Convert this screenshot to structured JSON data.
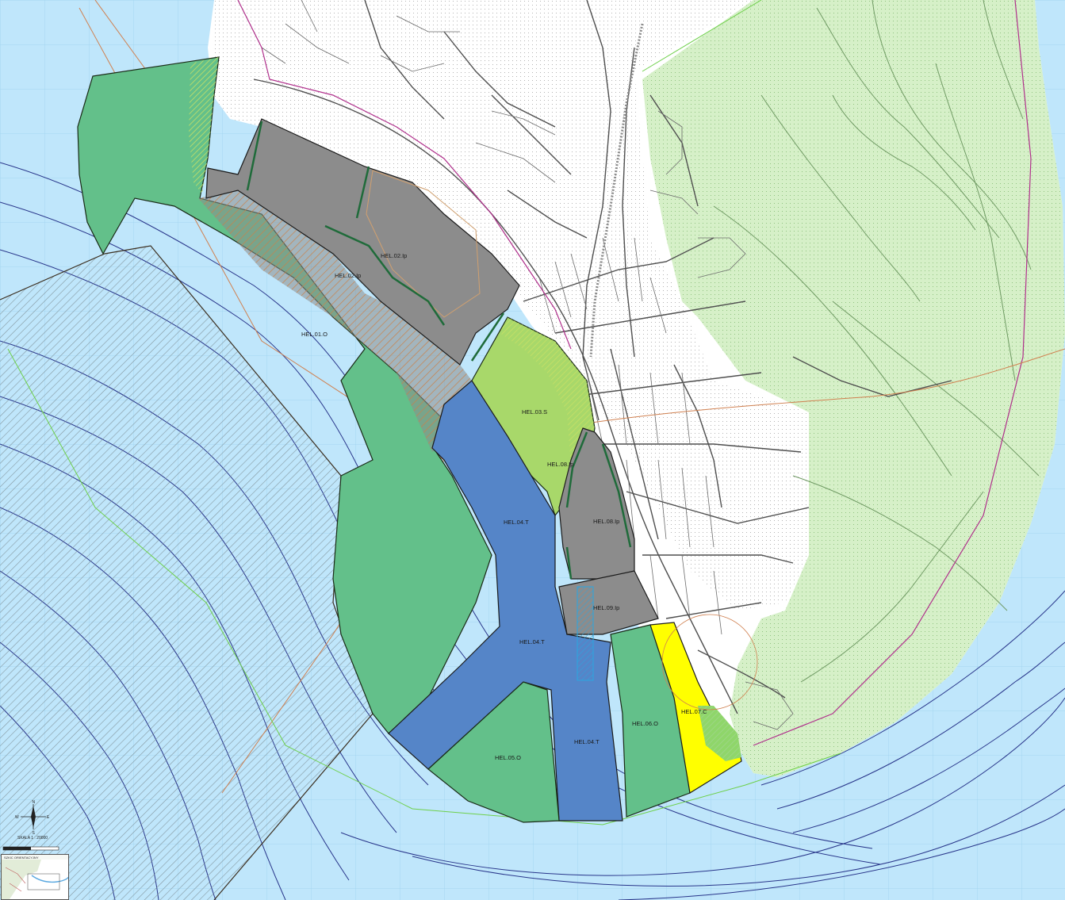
{
  "map": {
    "zones": [
      {
        "id": "HEL.01.O",
        "label": "HEL.01.O"
      },
      {
        "id": "HEL.02.Ip-a",
        "label": "HEL.02.Ip"
      },
      {
        "id": "HEL.02.Ip-b",
        "label": "HEL.02.Ip"
      },
      {
        "id": "HEL.03.S",
        "label": "HEL.03.S"
      },
      {
        "id": "HEL.04.T-a",
        "label": "HEL.04.T"
      },
      {
        "id": "HEL.04.T-b",
        "label": "HEL.04.T"
      },
      {
        "id": "HEL.04.T-c",
        "label": "HEL.04.T"
      },
      {
        "id": "HEL.05.O",
        "label": "HEL.05.O"
      },
      {
        "id": "HEL.06.O",
        "label": "HEL.06.O"
      },
      {
        "id": "HEL.07.C",
        "label": "HEL.07.C"
      },
      {
        "id": "HEL.08.Ip-a",
        "label": "HEL.08.Ip"
      },
      {
        "id": "HEL.08.Ip-b",
        "label": "HEL.08.Ip"
      },
      {
        "id": "HEL.09.Ip",
        "label": "HEL.09.Ip"
      }
    ],
    "colors": {
      "water": "#bfe6fb",
      "land": "#ffffff",
      "forest": "#d6f0c8",
      "zone_o": "#63c08a",
      "zone_ip": "#8c8c8c",
      "zone_s": "#a8d86a",
      "zone_t": "#5585c8",
      "zone_c": "#ffff00",
      "road": "#555555",
      "railway": "#888888",
      "boundary": "#000000"
    },
    "compass": {
      "n": "N",
      "e": "E",
      "s": "S",
      "w": "W"
    },
    "scale": {
      "label": "SKALA 1 : 20000"
    },
    "inset": {
      "title": "SZKIC ORIENTACYJNY"
    }
  }
}
